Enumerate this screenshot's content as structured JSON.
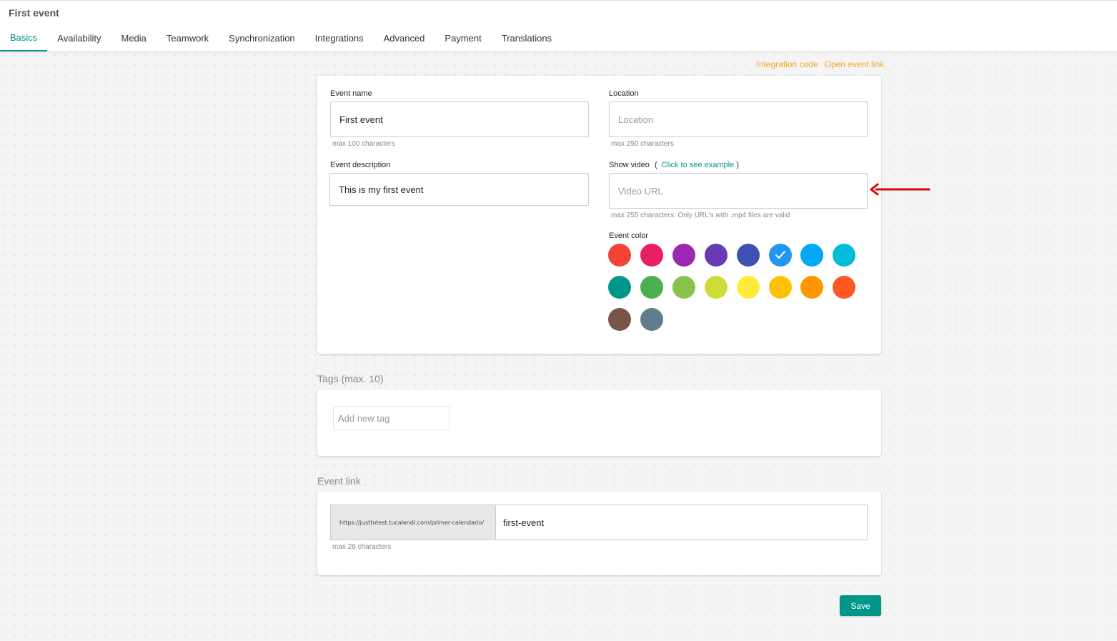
{
  "header": {
    "title": "First event",
    "tabs": [
      {
        "label": "Basics"
      },
      {
        "label": "Availability"
      },
      {
        "label": "Media"
      },
      {
        "label": "Teamwork"
      },
      {
        "label": "Synchronization"
      },
      {
        "label": "Integrations"
      },
      {
        "label": "Advanced"
      },
      {
        "label": "Payment"
      },
      {
        "label": "Translations"
      }
    ],
    "active_tab": "Basics"
  },
  "links": {
    "integration_code": "Integration code",
    "open_event_link": "Open event link"
  },
  "basics": {
    "event_name_label": "Event name",
    "event_name_value": "First event",
    "event_name_hint": "max 100 characters",
    "location_label": "Location",
    "location_placeholder": "Location",
    "location_hint": "max 250 characters",
    "description_label": "Event description",
    "description_value": "This is my first event",
    "video_label": "Show video",
    "video_paren_open": "(",
    "video_example_link": "Click to see example",
    "video_paren_close": ")",
    "video_placeholder": "Video URL",
    "video_hint": "max 255 characters. Only URL's with .mp4 files are valid",
    "color_label": "Event color",
    "selected_color": "#2196f3",
    "colors": [
      "#f44336",
      "#e91e63",
      "#9c27b0",
      "#673ab7",
      "#3f51b5",
      "#2196f3",
      "#03a9f4",
      "#00bcd4",
      "#009688",
      "#4caf50",
      "#8bc34a",
      "#cddc39",
      "#ffeb3b",
      "#ffc107",
      "#ff9800",
      "#ff5722",
      "#795548",
      "#607d8b"
    ]
  },
  "tags": {
    "title": "Tags (max. 10)",
    "placeholder": "Add new tag"
  },
  "event_link": {
    "title": "Event link",
    "prefix": "https://justtotest.tucalendi.com/primer-calendario/",
    "slug": "first-event",
    "hint": "max 28 characters"
  },
  "actions": {
    "save_label": "Save"
  },
  "accent_color": "#009688",
  "link_color": "#f5a623",
  "annotation_arrow_color": "#e00000"
}
